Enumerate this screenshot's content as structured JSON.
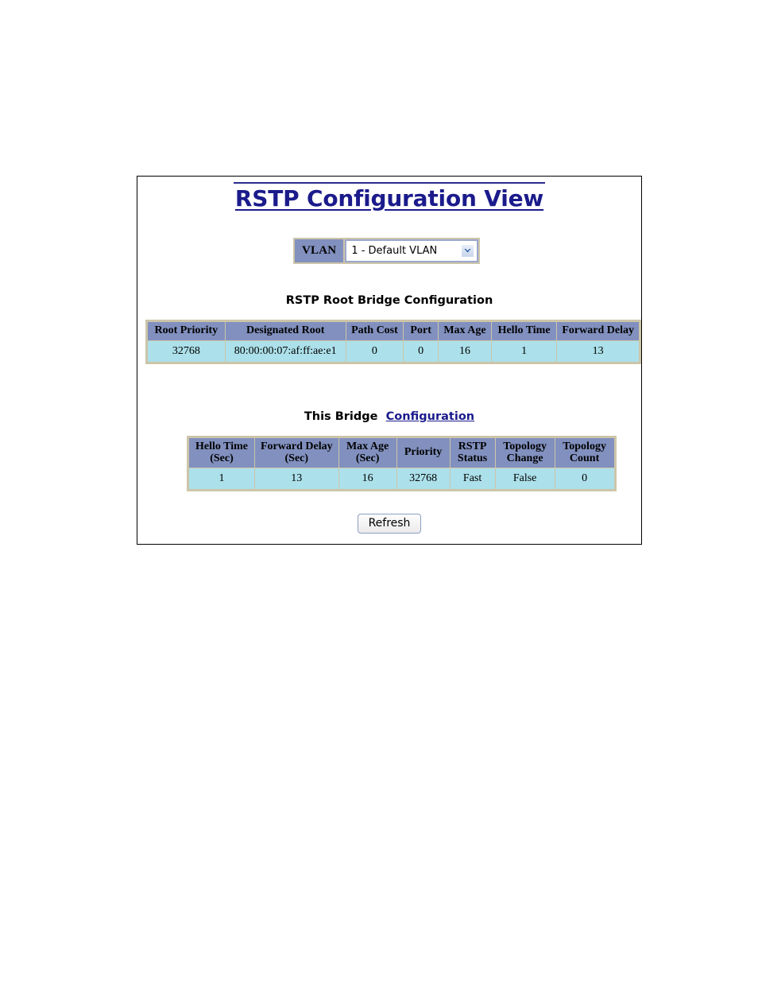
{
  "page": {
    "title": "RSTP Configuration View"
  },
  "vlan_selector": {
    "label": "VLAN",
    "selected": "1 - Default VLAN",
    "arrow_icon": "chevron-down-icon"
  },
  "root_bridge_section": {
    "caption": "RSTP Root Bridge Configuration",
    "columns": [
      "Root Priority",
      "Designated Root",
      "Path Cost",
      "Port",
      "Max Age",
      "Hello Time",
      "Forward Delay"
    ],
    "row": {
      "root_priority": "32768",
      "designated_root": "80:00:00:07:af:ff:ae:e1",
      "path_cost": "0",
      "port": "0",
      "max_age": "16",
      "hello_time": "1",
      "forward_delay": "13"
    }
  },
  "this_bridge_section": {
    "caption_static": "This Bridge",
    "caption_link": "Configuration",
    "columns": [
      {
        "line1": "Hello Time",
        "line2": "(Sec)"
      },
      {
        "line1": "Forward Delay",
        "line2": "(Sec)"
      },
      {
        "line1": "Max Age",
        "line2": "(Sec)"
      },
      {
        "line1": "Priority",
        "line2": ""
      },
      {
        "line1": "RSTP",
        "line2": "Status"
      },
      {
        "line1": "Topology",
        "line2": "Change"
      },
      {
        "line1": "Topology",
        "line2": "Count"
      }
    ],
    "row": {
      "hello_time": "1",
      "forward_delay": "13",
      "max_age": "16",
      "priority": "32768",
      "rstp_status": "Fast",
      "topology_change": "False",
      "topology_count": "0"
    }
  },
  "actions": {
    "refresh_label": "Refresh"
  },
  "colors": {
    "title": "#1b1b8c",
    "header_fill": "#8190be",
    "cell_fill": "#ace0ea",
    "table_border": "#cdc5a9",
    "link": "#1b1b8c"
  }
}
